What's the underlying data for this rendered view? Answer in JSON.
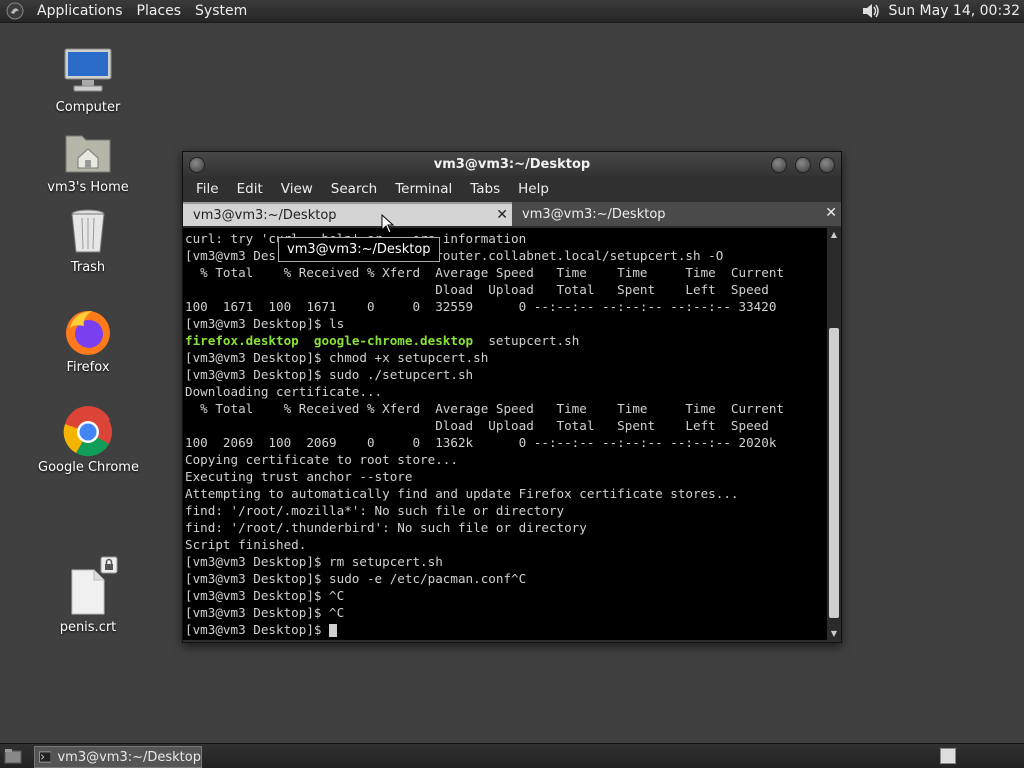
{
  "top_panel": {
    "menus": [
      "Applications",
      "Places",
      "System"
    ],
    "clock": "Sun May 14, 00:32"
  },
  "desktop_icons": [
    {
      "label": "Computer",
      "icon": "computer-icon"
    },
    {
      "label": "vm3's Home",
      "icon": "home-folder-icon"
    },
    {
      "label": "Trash",
      "icon": "trash-icon"
    },
    {
      "label": "Firefox",
      "icon": "firefox-icon"
    },
    {
      "label": "Google Chrome",
      "icon": "chrome-icon"
    },
    {
      "label": "penis.crt",
      "icon": "file-icon"
    }
  ],
  "window": {
    "title": "vm3@vm3:~/Desktop",
    "menus": [
      "File",
      "Edit",
      "View",
      "Search",
      "Terminal",
      "Tabs",
      "Help"
    ],
    "tabs": [
      {
        "label": "vm3@vm3:~/Desktop",
        "active": true
      },
      {
        "label": "vm3@vm3:~/Desktop",
        "active": false
      }
    ],
    "tooltip": "vm3@vm3:~/Desktop"
  },
  "terminal": {
    "lines": [
      "curl: try 'curl --help' or ...ore information",
      "[vm3@vm3 Des...                 /router.collabnet.local/setupcert.sh -O",
      "  % Total    % Received % Xferd  Average Speed   Time    Time     Time  Current",
      "                                 Dload  Upload   Total   Spent    Left  Speed",
      "100  1671  100  1671    0     0  32559      0 --:--:-- --:--:-- --:--:-- 33420",
      "[vm3@vm3 Desktop]$ ls",
      "",
      "[vm3@vm3 Desktop]$ chmod +x setupcert.sh",
      "[vm3@vm3 Desktop]$ sudo ./setupcert.sh",
      "Downloading certificate...",
      "  % Total    % Received % Xferd  Average Speed   Time    Time     Time  Current",
      "                                 Dload  Upload   Total   Spent    Left  Speed",
      "100  2069  100  2069    0     0  1362k      0 --:--:-- --:--:-- --:--:-- 2020k",
      "Copying certificate to root store...",
      "Executing trust anchor --store",
      "Attempting to automatically find and update Firefox certificate stores...",
      "find: '/root/.mozilla*': No such file or directory",
      "find: '/root/.thunderbird': No such file or directory",
      "Script finished.",
      "[vm3@vm3 Desktop]$ rm setupcert.sh",
      "[vm3@vm3 Desktop]$ sudo -e /etc/pacman.conf^C",
      "[vm3@vm3 Desktop]$ ^C",
      "[vm3@vm3 Desktop]$ ^C",
      "[vm3@vm3 Desktop]$"
    ],
    "ls_output": {
      "file1": "firefox.desktop",
      "file2": "google-chrome.desktop",
      "file3": "setupcert.sh"
    }
  },
  "bottom_panel": {
    "task_label": "vm3@vm3:~/Desktop"
  }
}
